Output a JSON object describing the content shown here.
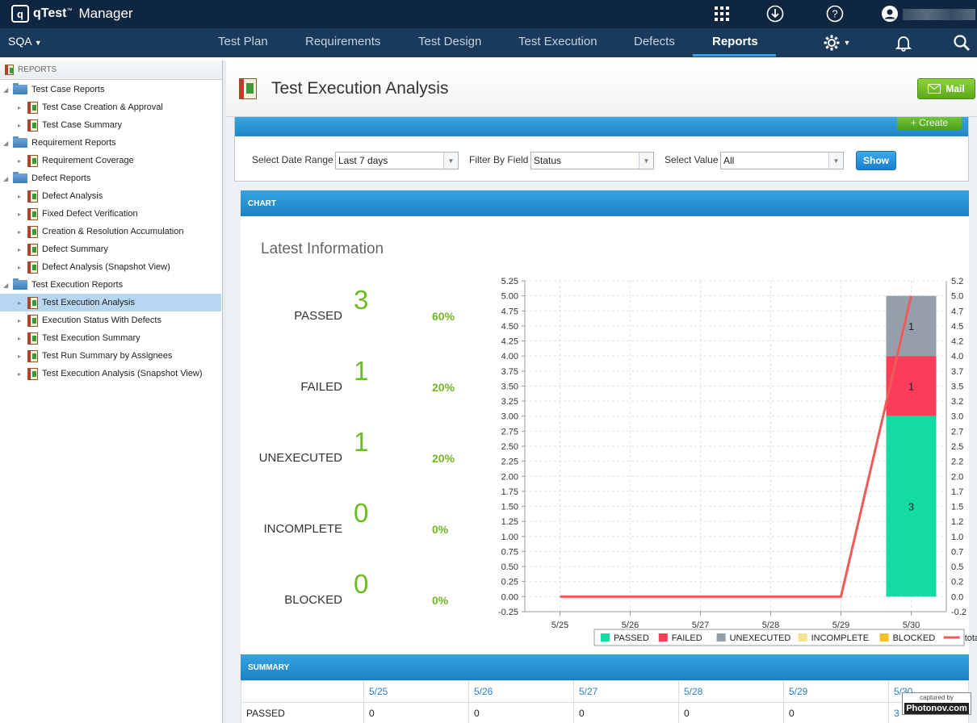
{
  "app": {
    "brand": "qTest",
    "product": "Manager",
    "project": "SQA"
  },
  "top_icons": [
    "apps-grid-icon",
    "download-icon",
    "help-icon",
    "user-avatar-icon"
  ],
  "nav": {
    "tabs": [
      "Test Plan",
      "Requirements",
      "Test Design",
      "Test Execution",
      "Defects",
      "Reports"
    ],
    "active_tab": "Reports"
  },
  "sidebar": {
    "header": "REPORTS",
    "groups": [
      {
        "label": "Test Case Reports",
        "items": [
          "Test Case Creation & Approval",
          "Test Case Summary"
        ]
      },
      {
        "label": "Requirement Reports",
        "items": [
          "Requirement Coverage"
        ]
      },
      {
        "label": "Defect Reports",
        "items": [
          "Defect Analysis",
          "Fixed Defect Verification",
          "Creation & Resolution Accumulation",
          "Defect Summary",
          "Defect Analysis (Snapshot View)"
        ]
      },
      {
        "label": "Test Execution Reports",
        "items": [
          "Test Execution Analysis",
          "Execution Status With Defects",
          "Test Execution Summary",
          "Test Run Summary by Assignees",
          "Test Execution Analysis (Snapshot View)"
        ]
      }
    ],
    "selected": "Test Execution Analysis"
  },
  "page": {
    "title": "Test Execution Analysis",
    "mail_label": "Mail",
    "create_label": "Create"
  },
  "filters": {
    "date_range_label": "Select Date Range",
    "date_range_value": "Last 7 days",
    "field_label": "Filter By Field",
    "field_value": "Status",
    "value_label": "Select Value",
    "value_value": "All",
    "show_label": "Show"
  },
  "chart_panel": {
    "header": "CHART",
    "latest_title": "Latest Information"
  },
  "latest_info": [
    {
      "status": "PASSED",
      "count": "3",
      "percent": "60%"
    },
    {
      "status": "FAILED",
      "count": "1",
      "percent": "20%"
    },
    {
      "status": "UNEXECUTED",
      "count": "1",
      "percent": "20%"
    },
    {
      "status": "INCOMPLETE",
      "count": "0",
      "percent": "0%"
    },
    {
      "status": "BLOCKED",
      "count": "0",
      "percent": "0%"
    }
  ],
  "chart_data": {
    "type": "bar",
    "stacked": true,
    "categories": [
      "5/25",
      "5/26",
      "5/27",
      "5/28",
      "5/29",
      "5/30"
    ],
    "series": [
      {
        "name": "PASSED",
        "color": "#12dca4",
        "values": [
          0,
          0,
          0,
          0,
          0,
          3
        ]
      },
      {
        "name": "FAILED",
        "color": "#fa3e5a",
        "values": [
          0,
          0,
          0,
          0,
          0,
          1
        ]
      },
      {
        "name": "UNEXECUTED",
        "color": "#959fa9",
        "values": [
          0,
          0,
          0,
          0,
          0,
          1
        ]
      },
      {
        "name": "INCOMPLETE",
        "color": "#f3e38e",
        "values": [
          0,
          0,
          0,
          0,
          0,
          0
        ]
      },
      {
        "name": "BLOCKED",
        "color": "#f4c11e",
        "values": [
          0,
          0,
          0,
          0,
          0,
          0
        ]
      }
    ],
    "line": {
      "name": "total",
      "color": "#f05a5a",
      "values": [
        0,
        0,
        0,
        0,
        0,
        5
      ]
    },
    "ylim": [
      -0.25,
      5.25
    ],
    "yticks": [
      "-0.25",
      "0.00",
      "0.25",
      "0.50",
      "0.75",
      "1.00",
      "1.25",
      "1.50",
      "1.75",
      "2.00",
      "2.25",
      "2.50",
      "2.75",
      "3.00",
      "3.25",
      "3.50",
      "3.75",
      "4.00",
      "4.25",
      "4.50",
      "4.75",
      "5.00",
      "5.25"
    ],
    "yticks_right": [
      "-0.2",
      "0.0",
      "0.2",
      "0.5",
      "0.7",
      "1.0",
      "1.2",
      "1.5",
      "1.7",
      "2.0",
      "2.2",
      "2.5",
      "2.7",
      "3.0",
      "3.2",
      "3.5",
      "3.7",
      "4.0",
      "4.2",
      "4.5",
      "4.7",
      "5.0",
      "5.2"
    ],
    "grid": true,
    "legend": "bottom"
  },
  "summary": {
    "header": "SUMMARY",
    "columns": [
      "",
      "5/25",
      "5/26",
      "5/27",
      "5/28",
      "5/29",
      "5/30"
    ],
    "rows": [
      {
        "label": "PASSED",
        "values": [
          "0",
          "0",
          "0",
          "0",
          "0",
          "3"
        ]
      }
    ]
  },
  "watermark": {
    "line1": "captured by",
    "line2": "Photonov.com"
  }
}
